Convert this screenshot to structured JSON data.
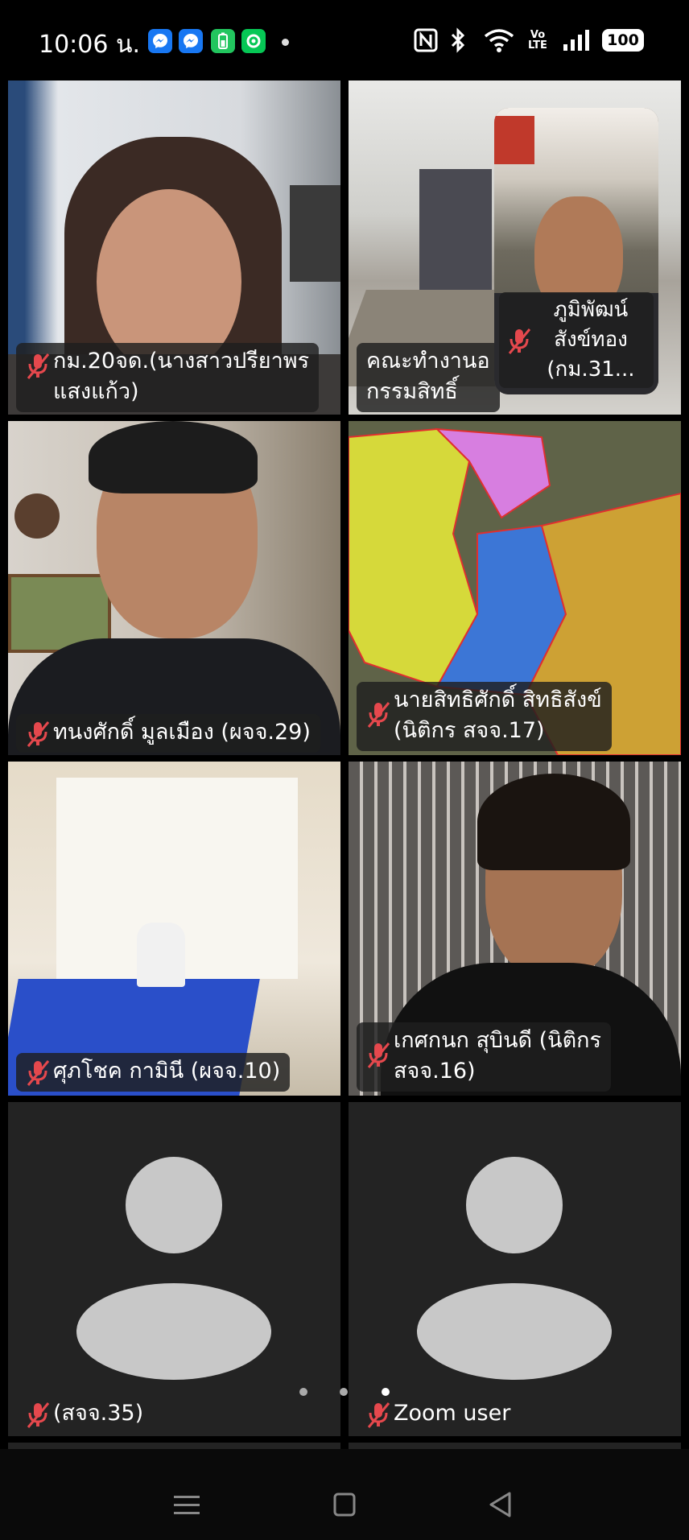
{
  "status_bar": {
    "time": "10:06 น.",
    "battery": "100",
    "notification_icons": [
      "messenger-icon",
      "messenger-icon",
      "battery-saver-icon",
      "line-icon"
    ],
    "system_icons": [
      "nfc-icon",
      "bluetooth-icon",
      "wifi-icon",
      "volte-icon",
      "signal-icon"
    ]
  },
  "tiles": [
    {
      "name_line1": "กม.20จด.(นางสาวปรียาพร",
      "name_line2": "แสงแก้ว)"
    },
    {
      "name_line1": "คณะทำงานอ",
      "name_line2": "กรรมสิทธิ์",
      "active": true
    },
    {
      "name_line1": "ทนงศักดิ์ มูลเมือง (ผจจ.29)"
    },
    {
      "name_line1": "นายสิทธิศักดิ์ สิทธิสังข์",
      "name_line2": "(นิติกร สจจ.17)"
    },
    {
      "name_line1": "ศุภโชค กามินี (ผจจ.10)"
    },
    {
      "name_line1": "เกศกนก สุบินดี (นิติกร",
      "name_line2": "สจจ.16)"
    },
    {
      "name_line1": "(สจจ.35)"
    },
    {
      "name_line1": "Zoom user"
    }
  ],
  "pip": {
    "name_line1": "ภูมิพัฒน์",
    "name_line2": "สังข์ทอง",
    "name_line3": "(กม.31..."
  },
  "colors": {
    "active_speaker": "#22c55e",
    "muted_mic": "#e5484d",
    "tile_bg": "#232323",
    "avatar": "#c8c8c8"
  },
  "nav_icons": [
    "menu-icon",
    "home-icon",
    "back-icon"
  ]
}
